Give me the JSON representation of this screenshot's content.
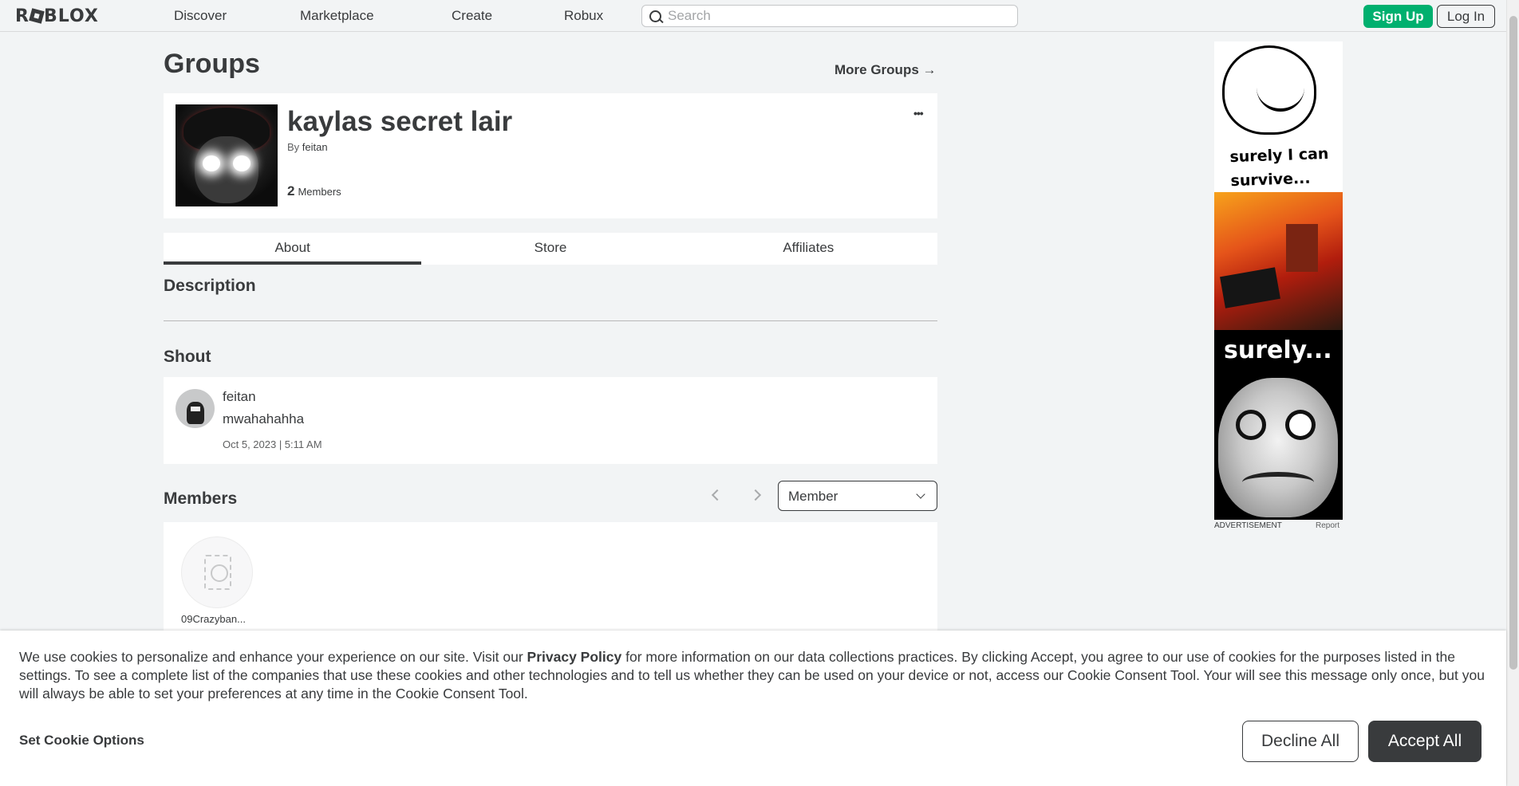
{
  "nav": {
    "logo": "ROBLOX",
    "links": [
      "Discover",
      "Marketplace",
      "Create",
      "Robux"
    ],
    "search_placeholder": "Search",
    "signup_label": "Sign Up",
    "login_label": "Log In"
  },
  "page": {
    "title": "Groups",
    "more_groups": "More Groups →"
  },
  "group": {
    "name": "kaylas secret lair",
    "by_prefix": "By",
    "owner": "feitan",
    "member_count": "2",
    "member_label": "Members",
    "menu": "•••"
  },
  "tabs": [
    "About",
    "Store",
    "Affiliates"
  ],
  "sections": {
    "description": "Description",
    "shout": "Shout",
    "members": "Members"
  },
  "shout": {
    "user": "feitan",
    "text": "mwahahahha",
    "date": "Oct 5, 2023 | 5:11 AM"
  },
  "members": {
    "role_selected": "Member",
    "list": [
      {
        "name": "09Crazyban..."
      }
    ]
  },
  "ad": {
    "caption_top_line1": "surely I can",
    "caption_top_line2": "survive...",
    "caption_bottom": "surely...",
    "label": "ADVERTISEMENT",
    "report": "Report"
  },
  "cookie": {
    "text_before": "We use cookies to personalize and enhance your experience on our site. Visit our ",
    "privacy_link": "Privacy Policy",
    "text_after": " for more information on our data collections practices. By clicking Accept, you agree to our use of cookies for the purposes listed in the settings. To see a complete list of the companies that use these cookies and other technologies and to tell us whether they can be used on your device or not, access our Cookie Consent Tool. Your will see this message only once, but you will always be able to set your preferences at any time in the Cookie Consent Tool.",
    "options_label": "Set Cookie Options",
    "decline_label": "Decline All",
    "accept_label": "Accept All"
  },
  "colors": {
    "signup_green": "#00b06f",
    "text_dark": "#393b3d",
    "background": "#f2f4f5"
  }
}
